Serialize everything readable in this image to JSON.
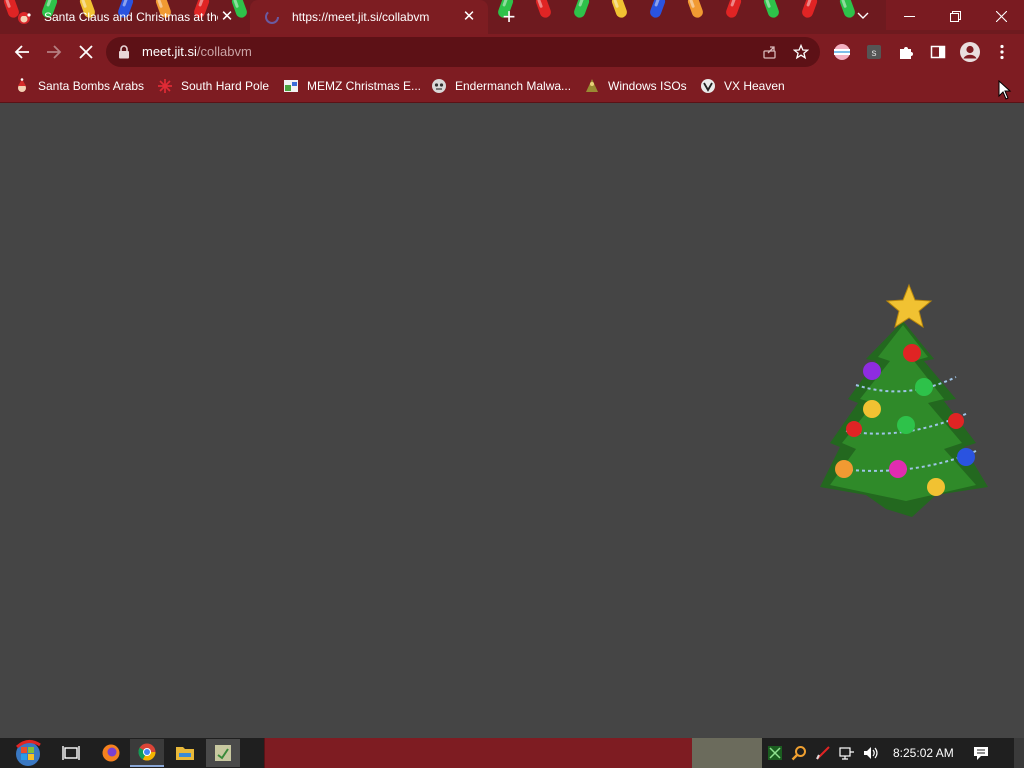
{
  "colors": {
    "accent": "#7e1c22",
    "content_bg": "#454545",
    "tabstrip_bg": "#6e1a1f"
  },
  "tabs": [
    {
      "title": "Santa Claus and Christmas at the",
      "favicon": "santa-favicon-icon",
      "close_icon": "close-icon"
    },
    {
      "title": "https://meet.jit.si/collabvm",
      "favicon": "loading-spinner-icon",
      "close_icon": "close-icon",
      "active": true
    }
  ],
  "new_tab_icon": "plus-icon",
  "window_controls": {
    "tab_search": "chevron-down-icon",
    "minimize": "minimize-icon",
    "restore": "restore-icon",
    "close": "close-icon"
  },
  "toolbar": {
    "back_icon": "arrow-left-icon",
    "forward_icon": "arrow-right-icon",
    "stop_icon": "close-icon",
    "url_host": "meet.jit.si",
    "url_path": "/collabvm",
    "share_icon": "share-icon",
    "bookmark_star_icon": "star-icon",
    "extensions": [
      "flag-extension-icon",
      "s-extension-icon",
      "puzzle-icon"
    ],
    "side_panel_icon": "side-panel-icon",
    "profile_icon": "avatar-icon",
    "menu_icon": "kebab-menu-icon"
  },
  "bookmarks": [
    {
      "label": "Santa Bombs Arabs",
      "icon": "santa-icon"
    },
    {
      "label": "South Hard Pole",
      "icon": "snowflake-icon"
    },
    {
      "label": "MEMZ Christmas E...",
      "icon": "memz-icon"
    },
    {
      "label": "Endermanch Malwa...",
      "icon": "endermanch-icon"
    },
    {
      "label": "Windows ISOs",
      "icon": "windows-iso-icon"
    },
    {
      "label": "VX Heaven",
      "icon": "vx-heaven-icon"
    }
  ],
  "content": {
    "decoration": "christmas-tree-icon"
  },
  "taskbar": {
    "start_icon": "windows-start-icon",
    "apps": [
      "task-view-icon",
      "firefox-icon",
      "chrome-icon",
      "file-explorer-icon",
      "app-icon"
    ],
    "tray": [
      "tray-app-icon",
      "search-tray-icon",
      "pen-tray-icon",
      "network-icon",
      "volume-icon"
    ],
    "clock": "8:25:02 AM",
    "notifications_icon": "notifications-icon"
  }
}
